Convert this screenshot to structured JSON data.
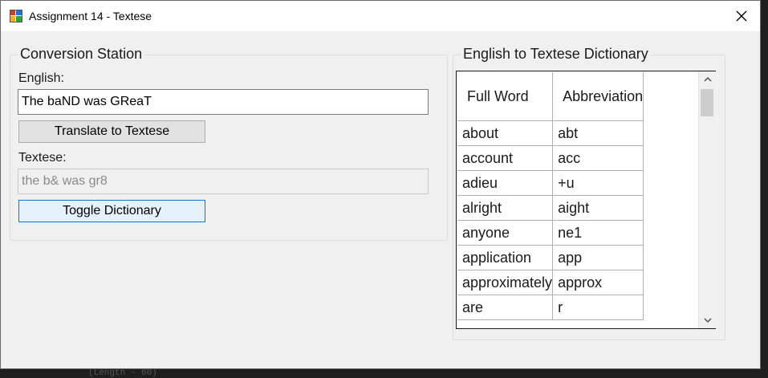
{
  "window": {
    "title": "Assignment 14 - Textese"
  },
  "conversion": {
    "group_title": "Conversion Station",
    "english_label": "English:",
    "english_value": "The baND was GReaT",
    "translate_button": "Translate to Textese",
    "textese_label": "Textese:",
    "textese_value": "the b& was gr8",
    "toggle_button": "Toggle Dictionary"
  },
  "dictionary": {
    "group_title": "English to Textese Dictionary",
    "columns": [
      "Full Word",
      "Abbreviation"
    ],
    "rows": [
      [
        "about",
        "abt"
      ],
      [
        "account",
        "acc"
      ],
      [
        "adieu",
        "+u"
      ],
      [
        "alright",
        "aight"
      ],
      [
        "anyone",
        "ne1"
      ],
      [
        "application",
        "app"
      ],
      [
        "approximately",
        "approx"
      ],
      [
        "are",
        "r"
      ]
    ]
  },
  "background_hint": "(Length - 60)",
  "icons": {
    "app": "app-window-icon",
    "close": "close-icon",
    "scroll_up": "chevron-up-icon",
    "scroll_down": "chevron-down-icon"
  }
}
